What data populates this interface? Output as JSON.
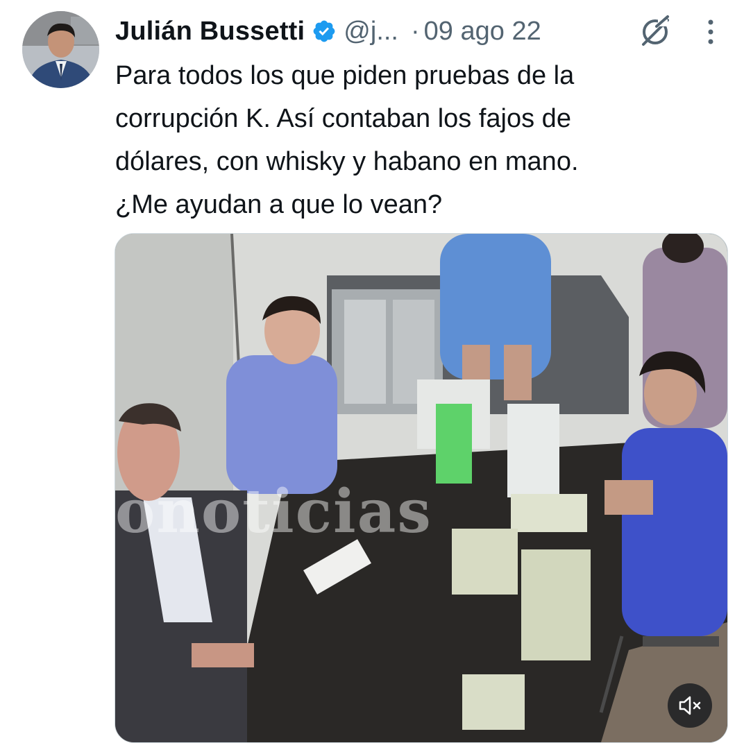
{
  "tweet": {
    "author_name": "Julián Bussetti",
    "handle": "@j...",
    "separator": "·",
    "date": "09 ago 22",
    "text": "Para todos los que piden pruebas de la\ncorrupción K. Así contaban los fajos de\ndólares, con whisky y habano en mano.\n¿Me ayudan a que lo vean?"
  },
  "media": {
    "watermark": "onoticias",
    "mute_icon": "speaker-muted-icon"
  },
  "icons": {
    "verified": "verified-badge-icon",
    "grok": "grok-icon",
    "more": "more-vertical-icon"
  },
  "colors": {
    "verified_blue": "#1d9bf0",
    "secondary_text": "#536471",
    "primary_text": "#0f1419"
  }
}
